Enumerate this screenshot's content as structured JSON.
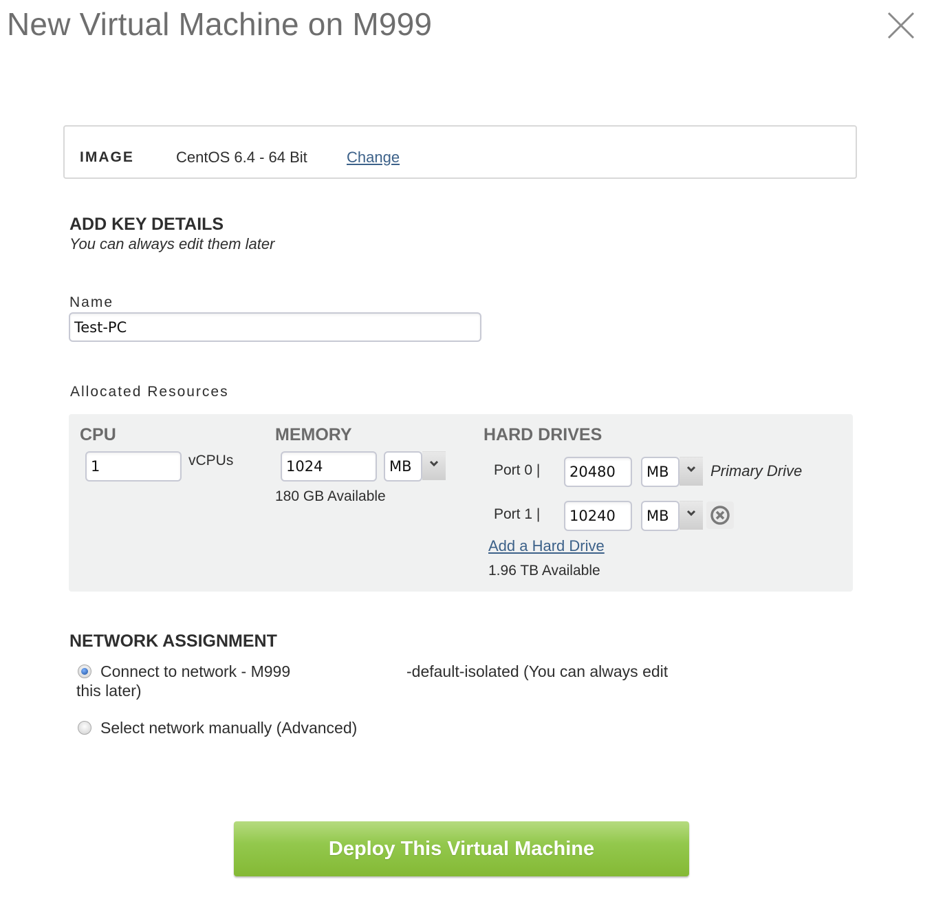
{
  "dialog": {
    "title": "New Virtual Machine on M999",
    "close_icon": "close-x-icon"
  },
  "image": {
    "label": "IMAGE",
    "value": "CentOS 6.4 - 64 Bit",
    "change_link": "Change"
  },
  "key_details": {
    "heading": "ADD KEY DETAILS",
    "subtitle": "You can always edit them later",
    "name_label": "Name",
    "name_value": "Test-PC"
  },
  "resources": {
    "heading": "Allocated Resources",
    "cpu": {
      "heading": "CPU",
      "value": "1",
      "unit": "vCPUs"
    },
    "memory": {
      "heading": "MEMORY",
      "value": "1024",
      "unit": "MB",
      "available": "180 GB Available"
    },
    "hard_drives": {
      "heading": "HARD DRIVES",
      "drives": [
        {
          "port": "Port 0 |",
          "value": "20480",
          "unit": "MB",
          "note": "Primary Drive"
        },
        {
          "port": "Port 1 |",
          "value": "10240",
          "unit": "MB",
          "remove_icon": "remove-circle-x-icon"
        }
      ],
      "add_link": "Add a Hard Drive",
      "available": "1.96 TB Available"
    }
  },
  "network": {
    "heading": "NETWORK ASSIGNMENT",
    "options": [
      {
        "label_part1": "Connect to network - M999",
        "label_part2": "-default-isolated (You can always edit",
        "label_part3": "this later)",
        "selected": true
      },
      {
        "label_part1": "Select network manually (Advanced)",
        "selected": false
      }
    ]
  },
  "actions": {
    "deploy_label": "Deploy This Virtual Machine",
    "deploy_color": "#8cc043"
  }
}
